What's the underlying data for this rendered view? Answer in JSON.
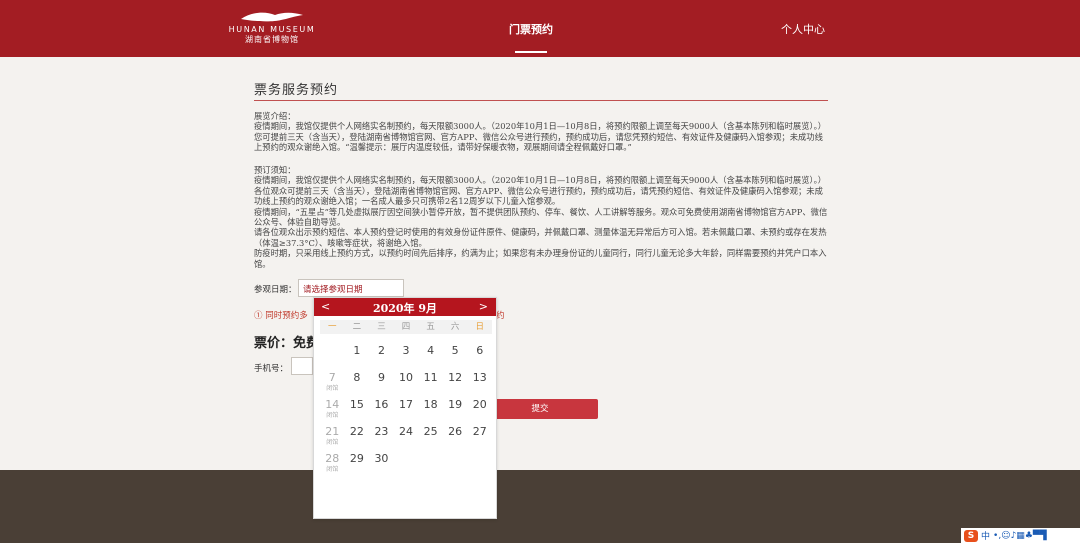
{
  "header": {
    "logo_en": "HUNAN MUSEUM",
    "logo_cn": "湖南省博物馆",
    "nav": [
      {
        "label": "门票预约",
        "active": true
      },
      {
        "label": "个人中心",
        "active": false
      }
    ]
  },
  "main": {
    "title": "票务服务预约",
    "para1": "展览介绍：\n疫情期间，我馆仅提供个人网络实名制预约，每天限额3000人。（2020年10月1日—10月8日，将预约限额上调至每天9000人（含基本陈列和临时展览）。）您可提前三天（含当天），登陆湖南省博物馆官网、官方APP、微信公众号进行预约，预约成功后，请您凭预约短信、有效证件及健康码入馆参观；未成功线上预约的观众谢绝入馆。“温馨提示：展厅内温度较低，请带好保暖衣物，观展期间请全程佩戴好口罩。”",
    "para2": "预订须知：\n疫情期间，我馆仅提供个人网络实名制预约，每天限额3000人。（2020年10月1日—10月8日，将预约限额上调至每天9000人（含基本陈列和临时展览）。）各位观众可提前三天（含当天），登陆湖南省博物馆官网、官方APP、微信公众号进行预约，预约成功后，请凭预约短信、有效证件及健康码入馆参观；未成功线上预约的观众谢绝入馆；一名成人最多只可携带2名12周岁以下儿童入馆参观。\n疫情期间，“五星占”等几处虚拟展厅因空间狭小暂停开放，暂不提供团队预约、停车、餐饮、人工讲解等服务。观众可免费使用湖南省博物馆官方APP、微信公众号、体验自助导览。\n请各位观众出示预约短信、本人预约登记时使用的有效身份证件原件、健康码，并佩戴口罩、测量体温无异常后方可入馆。若未佩戴口罩、未预约或存在发热（体温≥37.3°C）、咳嗽等症状，将谢绝入馆。\n防疫时期，只采用线上预约方式，以预约时间先后排序，约满为止；如果您有未办理身份证的儿童同行，同行儿童无论多大年龄，同样需要预约并凭户口本入馆。",
    "date_label": "参观日期：",
    "date_placeholder": "请选择参观日期",
    "warning": "① 同时预约多",
    "warning_tail": "约",
    "price": "票价：免费",
    "phone_label": "手机号：",
    "submit_label": "提交"
  },
  "calendar": {
    "prev": "<",
    "next": ">",
    "title": "2020年 9月",
    "weekdays": [
      "一",
      "二",
      "三",
      "四",
      "五",
      "六",
      "日"
    ],
    "closed_tag": "闭馆",
    "rows": [
      [
        "",
        "1",
        "2",
        "3",
        "4",
        "5",
        "6"
      ],
      [
        "7",
        "8",
        "9",
        "10",
        "11",
        "12",
        "13"
      ],
      [
        "14",
        "15",
        "16",
        "17",
        "18",
        "19",
        "20"
      ],
      [
        "21",
        "22",
        "23",
        "24",
        "25",
        "26",
        "27"
      ],
      [
        "28",
        "29",
        "30",
        "",
        "",
        "",
        ""
      ]
    ],
    "closed_days": [
      "7",
      "14",
      "21",
      "28"
    ]
  },
  "taskbar": {
    "ime_logo": "S",
    "ime_lang": "中",
    "ime_icons": "•,☺♪▦♣▀▜"
  },
  "colors": {
    "brand_red": "#a31d23",
    "footer_brown": "#4a3f36",
    "weekend_orange": "#e8a13a"
  }
}
